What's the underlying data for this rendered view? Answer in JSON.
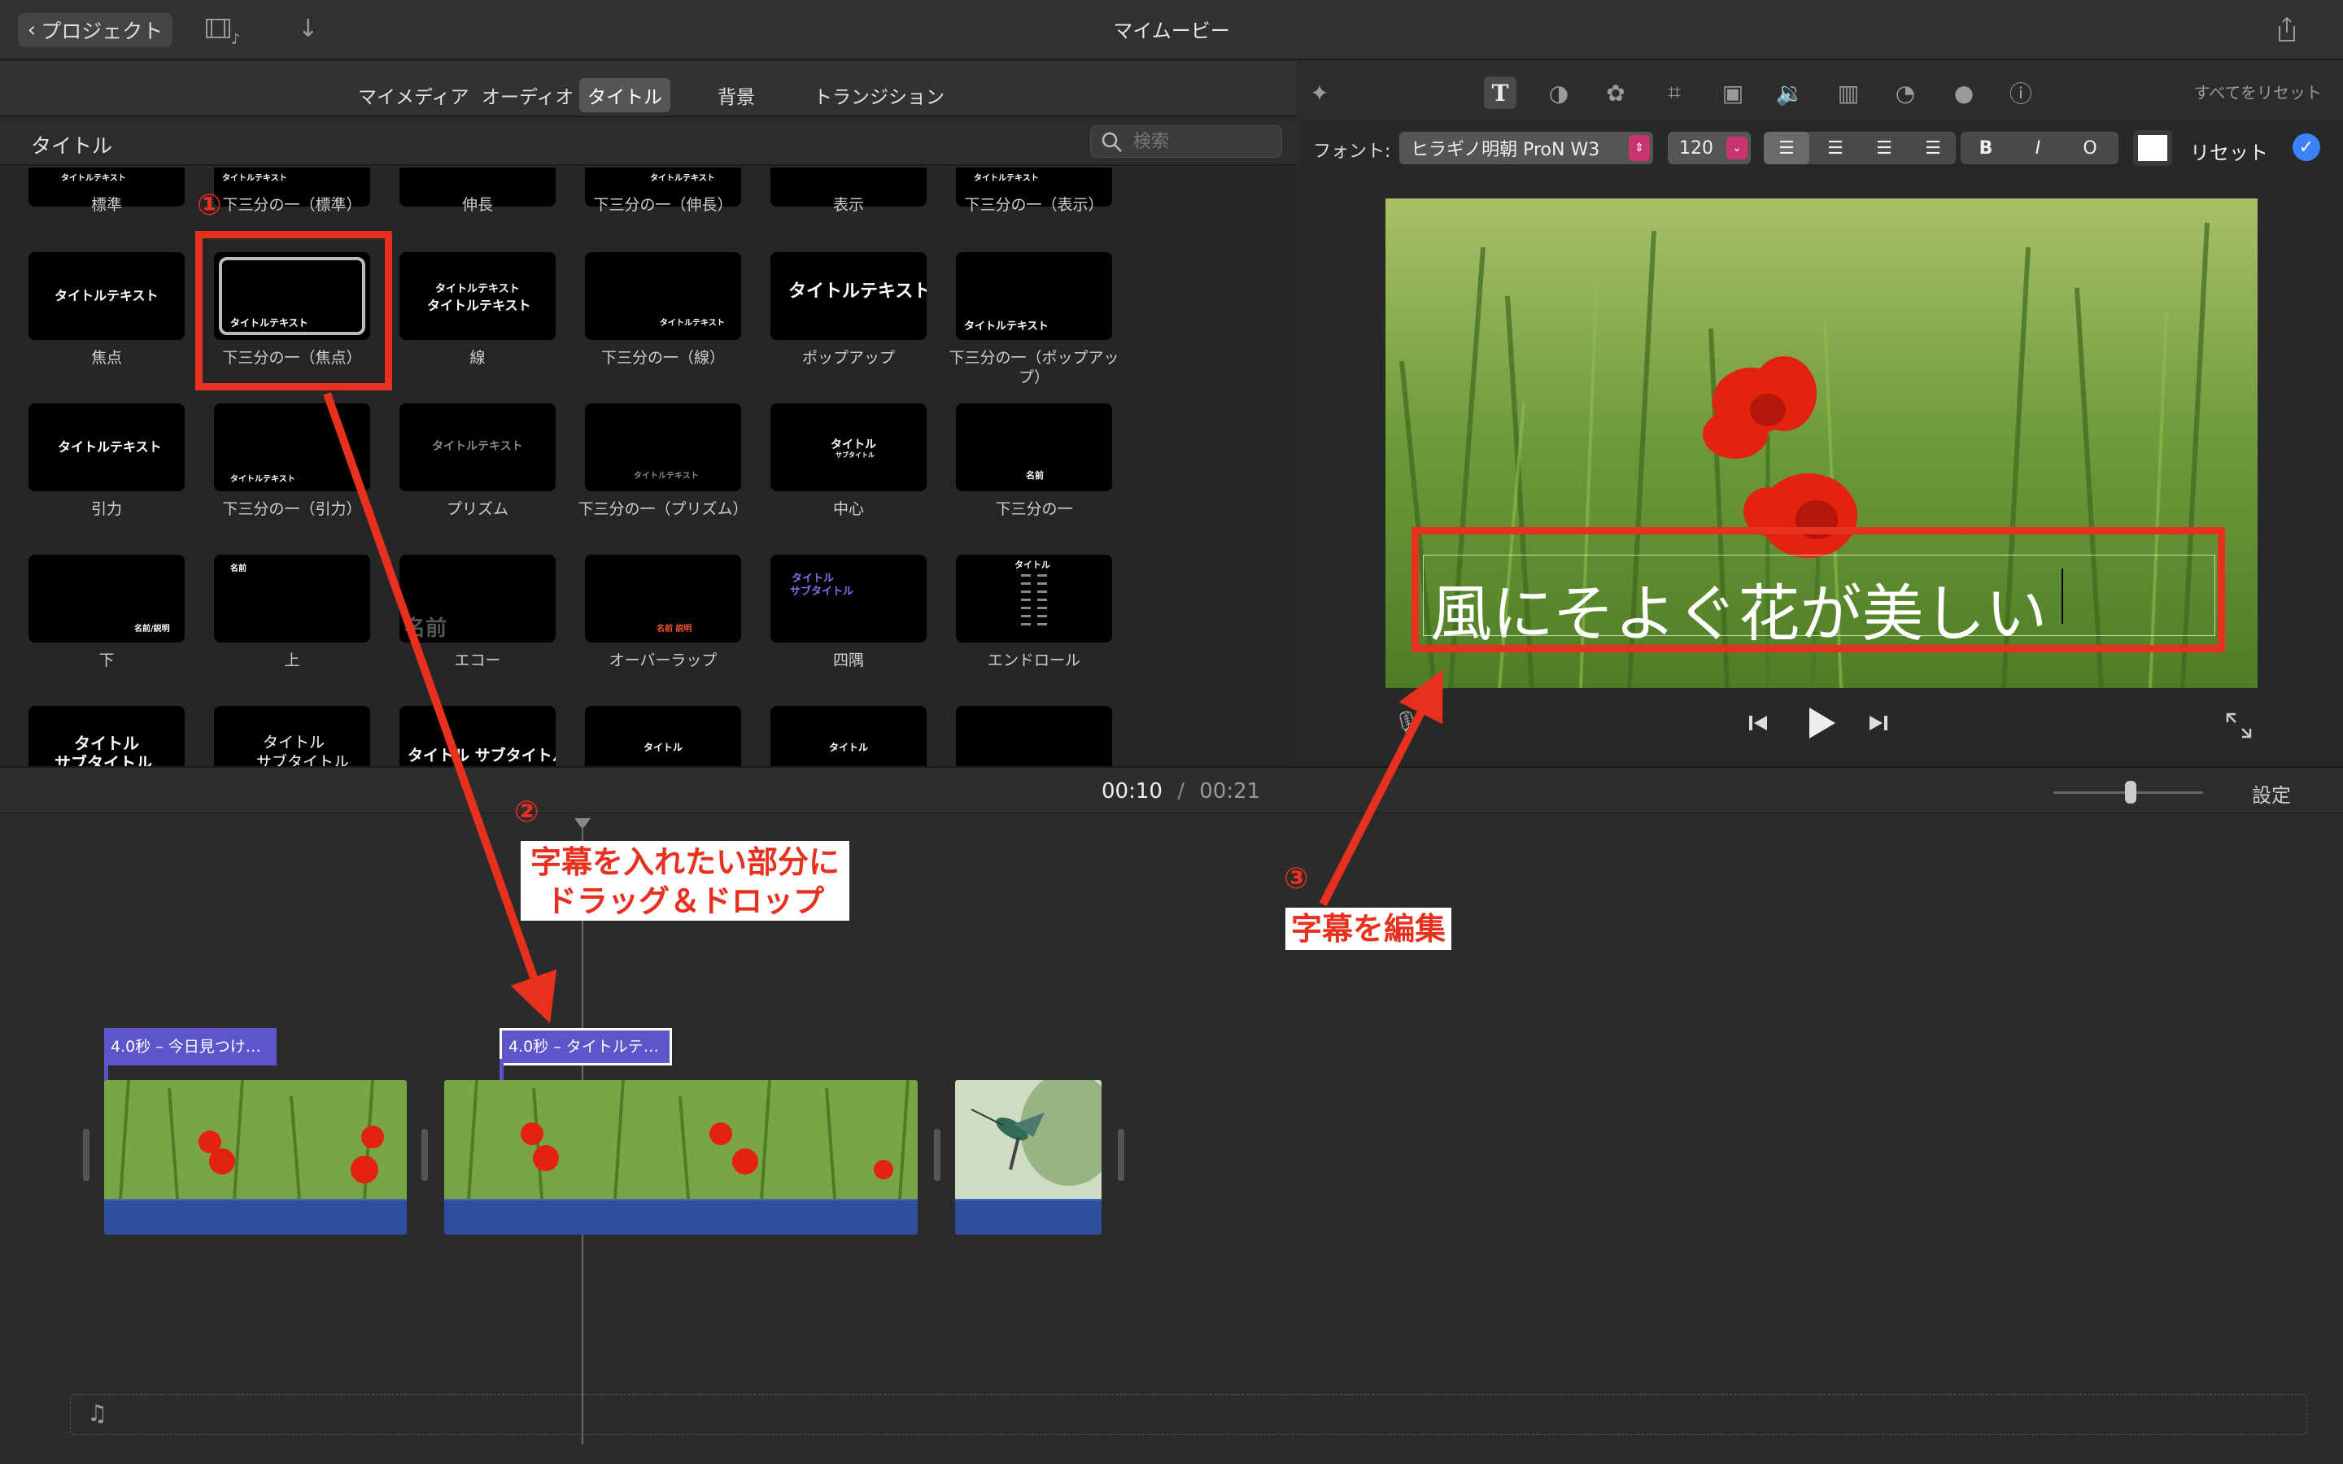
{
  "titlebar": {
    "back_label": "プロジェクト",
    "title": "マイムービー"
  },
  "media_tabs": [
    "マイメディア",
    "オーディオ",
    "タイトル",
    "背景",
    "トランジション"
  ],
  "media_tabs_active": "タイトル",
  "browser": {
    "title": "タイトル",
    "search_placeholder": "検索"
  },
  "tiles": [
    {
      "label": "標準",
      "text": "タイトルテキスト"
    },
    {
      "label": "下三分の一（標準）",
      "text": "タイトルテキスト"
    },
    {
      "label": "伸長",
      "text": ""
    },
    {
      "label": "下三分の一（伸長）",
      "text": "タイトルテキスト"
    },
    {
      "label": "表示",
      "text": ""
    },
    {
      "label": "下三分の一（表示）",
      "text": "タイトルテキスト"
    },
    {
      "label": "焦点",
      "text": "タイトルテキスト"
    },
    {
      "label": "下三分の一（焦点）",
      "text": "タイトルテキスト"
    },
    {
      "label": "線",
      "text": "タイトルテキスト"
    },
    {
      "label": "下三分の一（線）",
      "text": "タイトルテキスト"
    },
    {
      "label": "ポップアップ",
      "text": "タイトルテキスト"
    },
    {
      "label": "下三分の一（ポップアップ）",
      "text": "タイトルテキスト"
    },
    {
      "label": "引力",
      "text": "タイトルテキスト"
    },
    {
      "label": "下三分の一（引力）",
      "text": "タイトルテキスト"
    },
    {
      "label": "プリズム",
      "text": "タイトルテキスト"
    },
    {
      "label": "下三分の一（プリズム）",
      "text": "タイトルテキスト"
    },
    {
      "label": "中心",
      "text": "タイトル"
    },
    {
      "label": "下三分の一",
      "text": "名前"
    },
    {
      "label": "下",
      "text": "名前/説明"
    },
    {
      "label": "上",
      "text": "名前"
    },
    {
      "label": "エコー",
      "text": "名前"
    },
    {
      "label": "オーバーラップ",
      "text": "名前 説明"
    },
    {
      "label": "四隅",
      "text": "タイトル"
    },
    {
      "label": "エンドロール",
      "text": "タイトル"
    },
    {
      "label": "",
      "text": "タイトル"
    },
    {
      "label": "",
      "text": "タイトル"
    },
    {
      "label": "",
      "text": "タイトル サブタイトル"
    },
    {
      "label": "",
      "text": "タイトル"
    },
    {
      "label": "",
      "text": "タイトル"
    },
    {
      "label": "",
      "text": ""
    }
  ],
  "tile_text_extra": {
    "focus_line2": "",
    "line_line2": "タイトルテキスト",
    "center_sub": "サブタイトル",
    "corner_sub": "サブタイトル",
    "row5_sub": "サブタイトル"
  },
  "inspector": {
    "reset_all": "すべてをリセット",
    "font_label": "フォント:",
    "font_name": "ヒラギノ明朝 ProN W3",
    "font_size": "120",
    "bold": "B",
    "italic": "I",
    "outline": "O",
    "reset": "リセット",
    "text_color": "#ffffff"
  },
  "viewer": {
    "caption": "風にそよぐ花が美しい"
  },
  "timeline": {
    "current_time": "00:10",
    "separator": "/",
    "total_time": "00:21",
    "settings": "設定",
    "title_tag_1": "4.0秒 – 今日見つけ…",
    "title_tag_2": "4.0秒 – タイトルテ…"
  },
  "annotations": {
    "num1": "①",
    "num2": "②",
    "num3": "③",
    "step2_line1": "字幕を入れたい部分に",
    "step2_line2": "ドラッグ＆ドロップ",
    "step3": "字幕を編集"
  },
  "colors": {
    "annotation_red": "#e8301f",
    "title_clip": "#5d55c9",
    "audio_track": "#2f4f9e",
    "accent_blue": "#3b82f6"
  }
}
